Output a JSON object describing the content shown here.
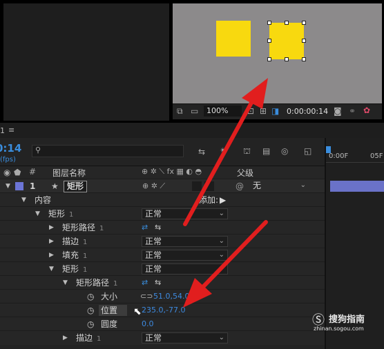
{
  "viewer": {
    "zoom": "100%",
    "timecode": "0:00:00:14"
  },
  "timeline": {
    "tab_number": "1",
    "current_time": "0:14",
    "fps": "(fps)",
    "columns": {
      "hash": "#",
      "layer_name": "图层名称",
      "parent": "父级"
    },
    "ruler": {
      "start": "0:00F",
      "next": "05F"
    },
    "layer": {
      "index": "1",
      "name": "矩形",
      "parent_value": "无"
    },
    "rows": {
      "contents": "内容",
      "add_label": "添加:",
      "rect1": "矩形",
      "rect1_num": "1",
      "rect1_mode": "正常",
      "path1": "矩形路径",
      "path1_num": "1",
      "stroke1": "描边",
      "stroke1_num": "1",
      "stroke1_mode": "正常",
      "fill1": "填充",
      "fill1_num": "1",
      "fill1_mode": "正常",
      "rect2": "矩形",
      "rect2_num": "1",
      "rect2_mode": "正常",
      "path2": "矩形路径",
      "path2_num": "1",
      "size_label": "大小",
      "size_value": "51.0,54.0",
      "position_label": "位置",
      "position_value": "235.0,-77.0",
      "roundness_label": "圆度",
      "roundness_value": "0.0",
      "stroke2": "描边",
      "stroke2_num": "1",
      "stroke2_mode": "正常"
    }
  },
  "watermark": {
    "brand": "搜狗指南",
    "url": "zhinan.sogou.com"
  },
  "colors": {
    "accent": "#3a8ddd",
    "shape": "#f8d90f",
    "arrow": "#e11e1e"
  }
}
